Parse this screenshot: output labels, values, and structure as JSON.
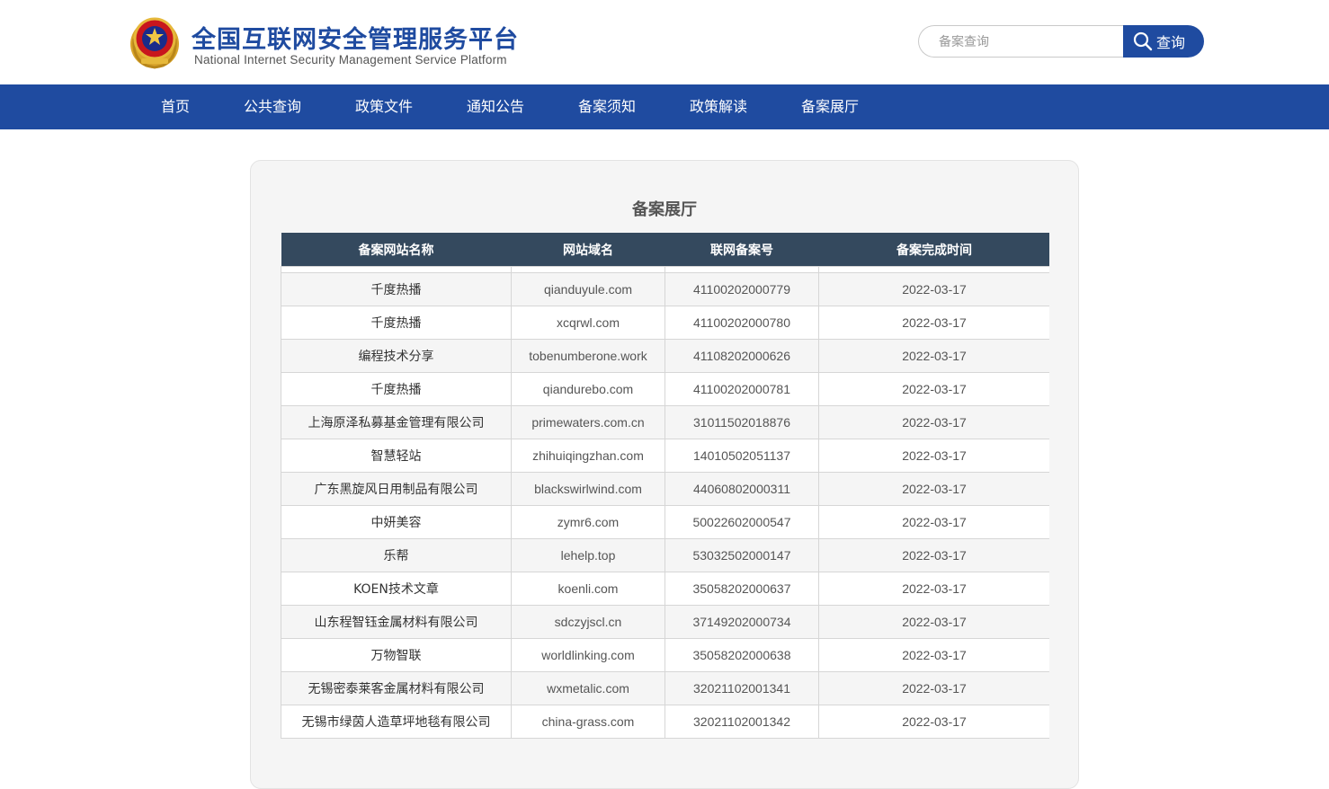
{
  "header": {
    "title": "全国互联网安全管理服务平台",
    "subtitle": "National Internet Security Management Service Platform",
    "search": {
      "placeholder": "备案查询",
      "button_label": "查询"
    }
  },
  "nav": {
    "items": [
      "首页",
      "公共查询",
      "政策文件",
      "通知公告",
      "备案须知",
      "政策解读",
      "备案展厅"
    ]
  },
  "main": {
    "title": "备案展厅",
    "columns": [
      "备案网站名称",
      "网站域名",
      "联网备案号",
      "备案完成时间"
    ],
    "rows": [
      [
        "千度热播",
        "qianduyule.com",
        "41100202000779",
        "2022-03-17"
      ],
      [
        "千度热播",
        "xcqrwl.com",
        "41100202000780",
        "2022-03-17"
      ],
      [
        "编程技术分享",
        "tobenumberone.work",
        "41108202000626",
        "2022-03-17"
      ],
      [
        "千度热播",
        "qiandurebo.com",
        "41100202000781",
        "2022-03-17"
      ],
      [
        "上海原泽私募基金管理有限公司",
        "primewaters.com.cn",
        "31011502018876",
        "2022-03-17"
      ],
      [
        "智慧轻站",
        "zhihuiqingzhan.com",
        "14010502051137",
        "2022-03-17"
      ],
      [
        "广东黑旋风日用制品有限公司",
        "blackswirlwind.com",
        "44060802000311",
        "2022-03-17"
      ],
      [
        "中妍美容",
        "zymr6.com",
        "50022602000547",
        "2022-03-17"
      ],
      [
        "乐帮",
        "lehelp.top",
        "53032502000147",
        "2022-03-17"
      ],
      [
        "KOEN技术文章",
        "koenli.com",
        "35058202000637",
        "2022-03-17"
      ],
      [
        "山东程智钰金属材料有限公司",
        "sdczyjscl.cn",
        "37149202000734",
        "2022-03-17"
      ],
      [
        "万物智联",
        "worldlinking.com",
        "35058202000638",
        "2022-03-17"
      ],
      [
        "无锡密泰莱客金属材料有限公司",
        "wxmetalic.com",
        "32021102001341",
        "2022-03-17"
      ],
      [
        "无锡市绿茵人造草坪地毯有限公司",
        "china-grass.com",
        "32021102001342",
        "2022-03-17"
      ]
    ]
  },
  "colors": {
    "primary": "#1f4ba0",
    "table_header": "#34495e"
  }
}
